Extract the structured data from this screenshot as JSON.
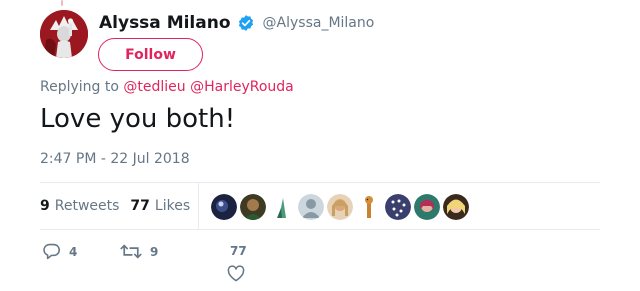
{
  "tweet": {
    "author": {
      "display_name": "Alyssa Milano",
      "handle": "@Alyssa_Milano",
      "verified": true,
      "avatar_icon": "statue-of-liberty-avatar"
    },
    "follow_label": "Follow",
    "replying_to": {
      "prefix": "Replying to",
      "mentions": [
        "@tedlieu",
        "@HarleyRouda"
      ]
    },
    "text": "Love you both!",
    "timestamp": "2:47 PM - 22 Jul 2018",
    "stats": {
      "retweets_count": "9",
      "retweets_label": "Retweets",
      "likes_count": "77",
      "likes_label": "Likes"
    },
    "likers": [
      {
        "name": "liker-avatar-1",
        "color": "#1b2340"
      },
      {
        "name": "liker-avatar-2",
        "color": "#5a4a2c"
      },
      {
        "name": "liker-avatar-3",
        "color": "#ffffff"
      },
      {
        "name": "liker-avatar-4",
        "color": "#aab8c2"
      },
      {
        "name": "liker-avatar-5",
        "color": "#c9a97f"
      },
      {
        "name": "liker-avatar-6",
        "color": "#ffffff"
      },
      {
        "name": "liker-avatar-7",
        "color": "#3a3f6e"
      },
      {
        "name": "liker-avatar-8",
        "color": "#b05a78"
      },
      {
        "name": "liker-avatar-9",
        "color": "#e8c36a"
      }
    ],
    "actions": {
      "reply_count": "4",
      "retweet_count": "9",
      "like_count": "77"
    }
  },
  "colors": {
    "accent": "#e0245e",
    "verified": "#1da1f2",
    "secondary_text": "#657786",
    "primary_text": "#14171a",
    "divider": "#e6ecf0"
  }
}
